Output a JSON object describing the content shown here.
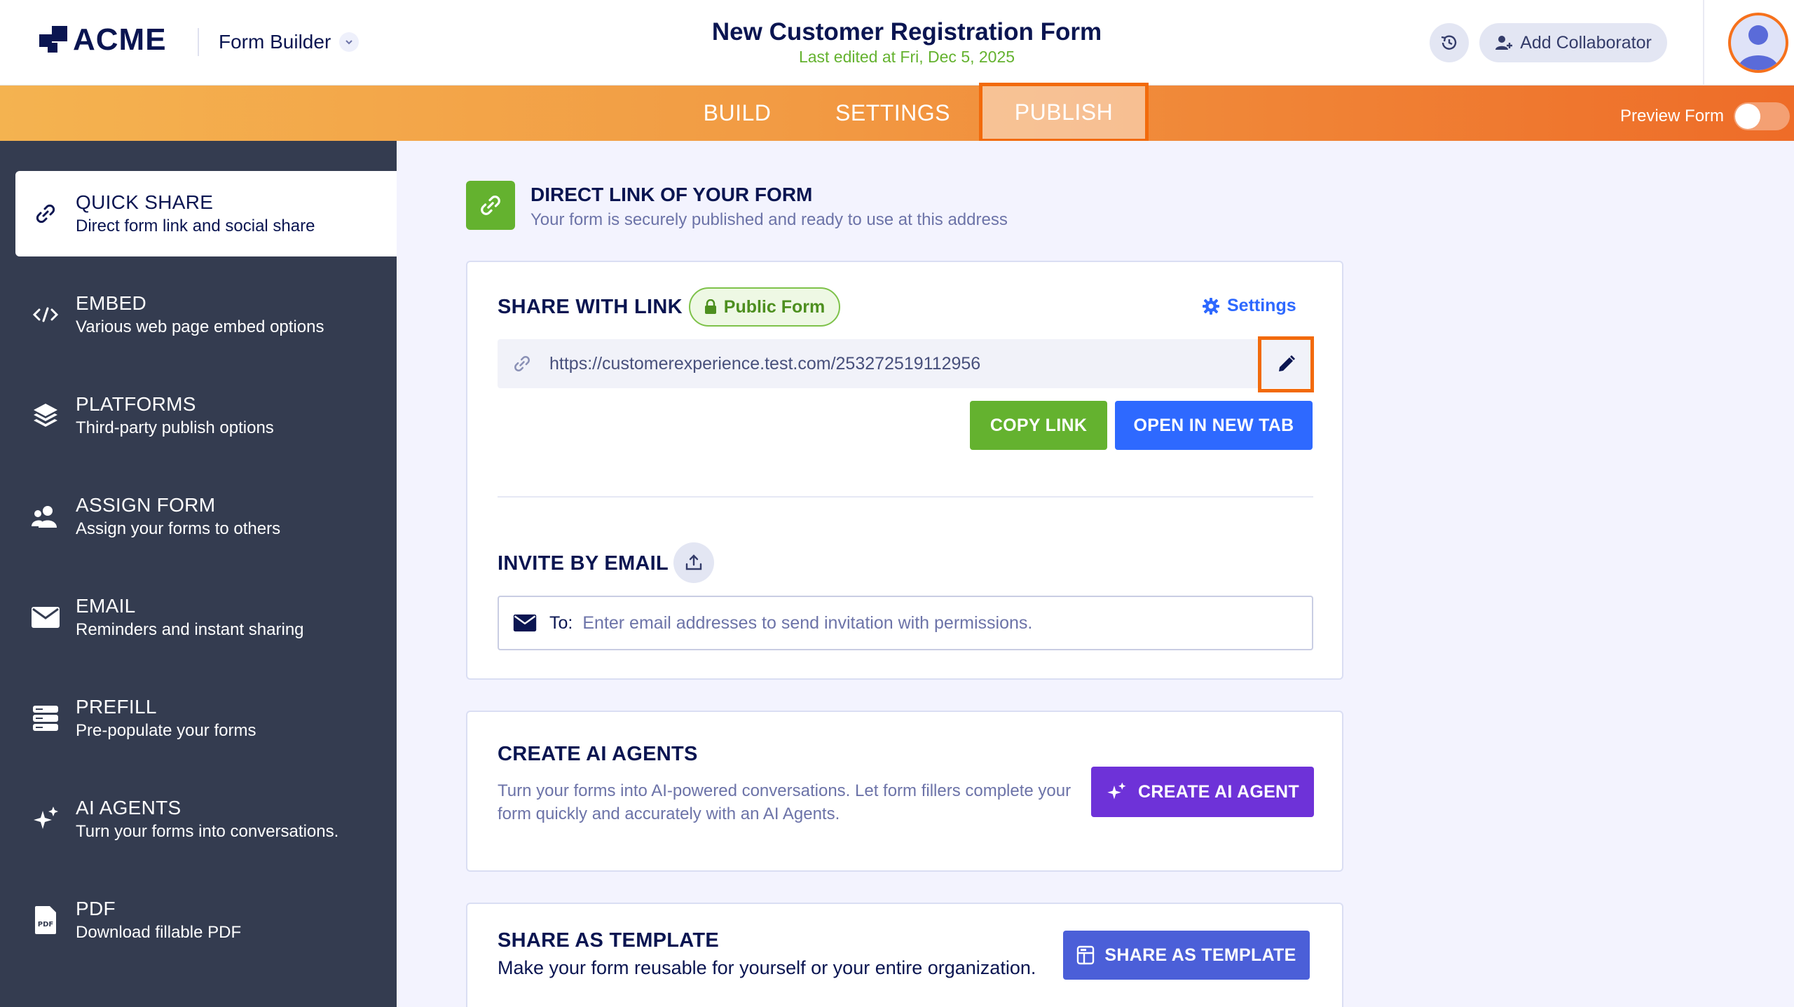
{
  "header": {
    "brand": "ACME",
    "builder_menu": "Form Builder",
    "form_title": "New Customer Registration Form",
    "last_edited": "Last edited at Fri, Dec 5, 2025",
    "add_collaborator": "Add Collaborator",
    "icons": [
      "acme-logo",
      "chevron-down-icon",
      "history-icon",
      "add-user-icon",
      "avatar-icon"
    ]
  },
  "tabs": {
    "items": [
      {
        "label": "BUILD",
        "active": false
      },
      {
        "label": "SETTINGS",
        "active": false
      },
      {
        "label": "PUBLISH",
        "active": true
      }
    ],
    "preview_label": "Preview Form",
    "preview_enabled": false
  },
  "sidebar": {
    "items": [
      {
        "title": "QUICK SHARE",
        "desc": "Direct form link and social share",
        "icon": "link-icon",
        "active": true
      },
      {
        "title": "EMBED",
        "desc": "Various web page embed options",
        "icon": "code-icon",
        "active": false
      },
      {
        "title": "PLATFORMS",
        "desc": "Third-party publish options",
        "icon": "layers-icon",
        "active": false
      },
      {
        "title": "ASSIGN FORM",
        "desc": "Assign your forms to others",
        "icon": "users-icon",
        "active": false
      },
      {
        "title": "EMAIL",
        "desc": "Reminders and instant sharing",
        "icon": "envelope-icon",
        "active": false
      },
      {
        "title": "PREFILL",
        "desc": "Pre-populate your forms",
        "icon": "prefill-icon",
        "active": false
      },
      {
        "title": "AI AGENTS",
        "desc": "Turn your forms into conversations.",
        "icon": "sparkles-icon",
        "active": false
      },
      {
        "title": "PDF",
        "desc": "Download fillable PDF",
        "icon": "pdf-icon",
        "active": false
      }
    ]
  },
  "direct_link": {
    "title": "DIRECT LINK OF YOUR FORM",
    "subtitle": "Your form is securely published and ready to use at this address"
  },
  "share_link": {
    "label": "SHARE WITH LINK",
    "badge": "Public Form",
    "settings_label": "Settings",
    "url": "https://customerexperience.test.com/253272519112956",
    "copy_button": "COPY LINK",
    "open_button": "OPEN IN NEW TAB"
  },
  "invite": {
    "label": "INVITE BY EMAIL",
    "to_label": "To:",
    "placeholder": "Enter email addresses to send invitation with permissions."
  },
  "ai_agents": {
    "title": "CREATE AI AGENTS",
    "description": "Turn your forms into AI-powered conversations. Let form fillers complete your form quickly and accurately with an AI Agents.",
    "button": "CREATE AI AGENT"
  },
  "template": {
    "title": "SHARE AS TEMPLATE",
    "description": "Make your form reusable for yourself or your entire organization.",
    "button": "SHARE AS TEMPLATE"
  },
  "colors": {
    "navy": "#0a1551",
    "green": "#64b22f",
    "blue": "#2e69ff",
    "purple": "#6e32d8",
    "indigo": "#4b5fd8",
    "orange_highlight": "#f26a0b",
    "sidebar_bg": "#343c50"
  }
}
